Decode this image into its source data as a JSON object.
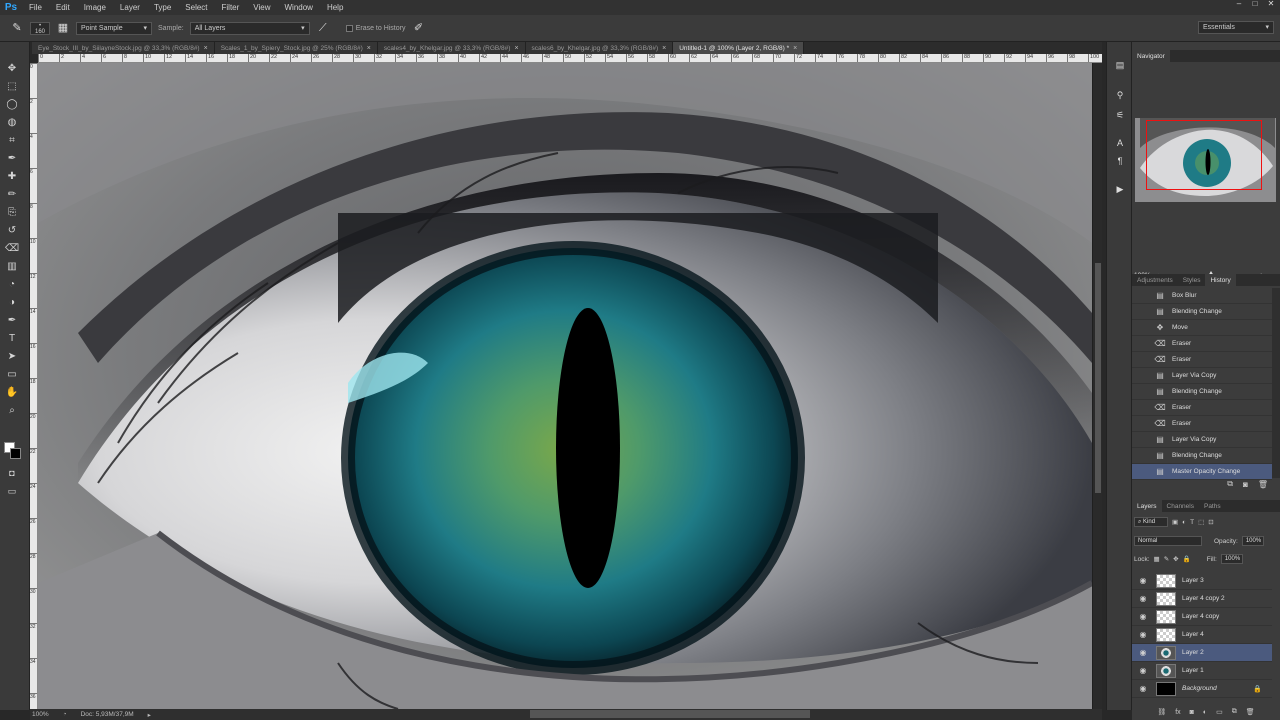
{
  "app": {
    "logo": "Ps"
  },
  "menu": [
    "File",
    "Edit",
    "Image",
    "Layer",
    "Type",
    "Select",
    "Filter",
    "View",
    "Window",
    "Help"
  ],
  "window_controls": [
    "–",
    "□",
    "✕"
  ],
  "options_bar": {
    "brush_size": "160",
    "sample_size": "Point Sample",
    "sample_label": "Sample:",
    "sample_layers": "All Layers",
    "erase_to_history": "Erase to History",
    "workspace": "Essentials"
  },
  "tabs": [
    {
      "label": "Eye_Stock_III_by_SiilayneStock.jpg @ 33,3% (RGB/8#)",
      "active": false
    },
    {
      "label": "Scales_1_by_Spiery_Stock.jpg @ 25% (RGB/8#)",
      "active": false
    },
    {
      "label": "scales4_by_Khelgar.jpg @ 33,3% (RGB/8#)",
      "active": false
    },
    {
      "label": "scales6_by_Khelgar.jpg @ 33,3% (RGB/8#)",
      "active": false
    },
    {
      "label": "Untitled-1 @ 100% (Layer 2, RGB/8) *",
      "active": true
    }
  ],
  "ruler_top": [
    "0",
    "2",
    "4",
    "6",
    "8",
    "10",
    "12",
    "14",
    "16",
    "18",
    "20",
    "22",
    "24",
    "26",
    "28",
    "30",
    "32",
    "34",
    "36",
    "38",
    "40",
    "42",
    "44",
    "46",
    "48",
    "50",
    "52",
    "54",
    "56",
    "58",
    "60",
    "62",
    "64",
    "66",
    "68",
    "70",
    "72",
    "74",
    "76",
    "78",
    "80",
    "82",
    "84",
    "86",
    "88",
    "90",
    "92",
    "94",
    "96",
    "98",
    "100",
    "102",
    "104"
  ],
  "ruler_left": [
    "0",
    "2",
    "4",
    "6",
    "8",
    "10",
    "12",
    "14",
    "16",
    "18",
    "20",
    "22",
    "24",
    "26",
    "28",
    "30",
    "32",
    "34",
    "36"
  ],
  "tools": [
    "move-tool",
    "marquee-tool",
    "lasso-tool",
    "quick-select-tool",
    "crop-tool",
    "eyedropper-tool",
    "healing-tool",
    "brush-tool",
    "clone-stamp-tool",
    "history-brush-tool",
    "eraser-tool",
    "gradient-tool",
    "blur-tool",
    "dodge-tool",
    "pen-tool",
    "type-tool",
    "path-select-tool",
    "shape-tool",
    "hand-tool",
    "zoom-tool"
  ],
  "status": {
    "zoom": "100%",
    "doc": "Doc: 5,93M/37,9M"
  },
  "navigator": {
    "title": "Navigator",
    "zoom": "100%"
  },
  "history": {
    "tabs": [
      "Adjustments",
      "Styles",
      "History"
    ],
    "active_tab": "History",
    "items": [
      {
        "label": "Box Blur",
        "icon": "document-icon",
        "active": false
      },
      {
        "label": "Blending Change",
        "icon": "document-icon",
        "active": false
      },
      {
        "label": "Move",
        "icon": "move-icon",
        "active": false
      },
      {
        "label": "Eraser",
        "icon": "eraser-icon",
        "active": false
      },
      {
        "label": "Eraser",
        "icon": "eraser-icon",
        "active": false
      },
      {
        "label": "Layer Via Copy",
        "icon": "document-icon",
        "active": false
      },
      {
        "label": "Blending Change",
        "icon": "document-icon",
        "active": false
      },
      {
        "label": "Eraser",
        "icon": "eraser-icon",
        "active": false
      },
      {
        "label": "Eraser",
        "icon": "eraser-icon",
        "active": false
      },
      {
        "label": "Layer Via Copy",
        "icon": "document-icon",
        "active": false
      },
      {
        "label": "Blending Change",
        "icon": "document-icon",
        "active": false
      },
      {
        "label": "Master Opacity Change",
        "icon": "document-icon",
        "active": true
      }
    ]
  },
  "layers": {
    "tabs": [
      "Layers",
      "Channels",
      "Paths"
    ],
    "active_tab": "Layers",
    "filter": "Kind",
    "blend_mode": "Normal",
    "opacity_label": "Opacity:",
    "opacity": "100%",
    "lock_label": "Lock:",
    "fill_label": "Fill:",
    "fill": "100%",
    "items": [
      {
        "name": "Layer 3",
        "thumb": "transparent",
        "active": false,
        "locked": false
      },
      {
        "name": "Layer 4 copy 2",
        "thumb": "transparent",
        "active": false,
        "locked": false
      },
      {
        "name": "Layer 4 copy",
        "thumb": "transparent",
        "active": false,
        "locked": false
      },
      {
        "name": "Layer 4",
        "thumb": "transparent",
        "active": false,
        "locked": false
      },
      {
        "name": "Layer 2",
        "thumb": "image",
        "active": true,
        "locked": false
      },
      {
        "name": "Layer 1",
        "thumb": "image",
        "active": false,
        "locked": false
      },
      {
        "name": "Background",
        "thumb": "black",
        "active": false,
        "locked": true
      }
    ]
  },
  "colors": {
    "accent_selection": "#4b5a7e",
    "iris_outer": "#0d3a44",
    "iris_inner": "#3a8a6a",
    "pupil": "#000000"
  }
}
